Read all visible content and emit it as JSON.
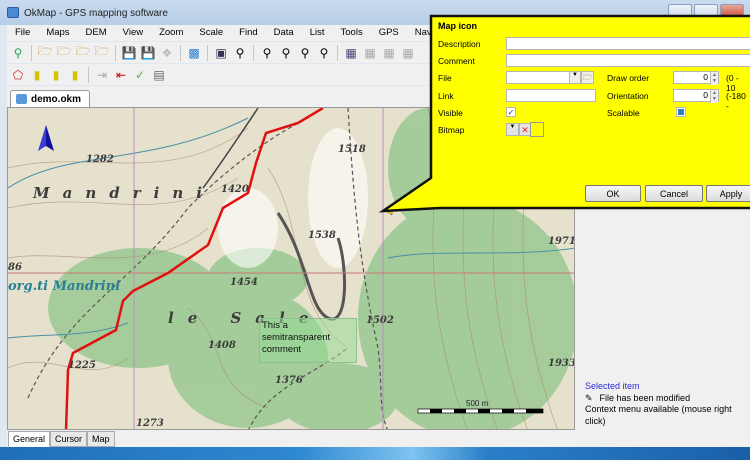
{
  "window": {
    "title": "OkMap - GPS mapping software"
  },
  "menu": [
    "File",
    "Maps",
    "DEM",
    "View",
    "Zoom",
    "Scale",
    "Find",
    "Data",
    "List",
    "Tools",
    "GPS",
    "Navigate"
  ],
  "toolbar_row1": [
    "find-map-icon",
    "open-map-icon",
    "open-calibrated-icon",
    "open-vector-icon",
    "open-image-icon",
    "save-as-icon",
    "save-icon",
    "save-disabled-icon",
    "select-map-icon",
    "map-properties-icon",
    "search-icon",
    "zoom-in-icon",
    "zoom-out-icon",
    "zoom-fit-icon",
    "zoom-1-1-icon",
    "grid-edit-icon",
    "grid-add-icon",
    "grid-fill-icon",
    "grid-delete-icon"
  ],
  "toolbar_row2": [
    "polygon-icon",
    "ruler-icon",
    "ruler-area-icon",
    "ruler-delete-icon",
    "import-disabled-icon",
    "export-red-icon",
    "export-check-icon",
    "properties-icon"
  ],
  "document_tab": "demo.okm",
  "map": {
    "labels": [
      "1282",
      "1420",
      "1518",
      "1538",
      "1971",
      "Mandrini",
      "86",
      "org.ti Mandrini",
      "1454",
      "le Sale",
      "1502",
      "1408",
      "1225",
      "1376",
      "1933",
      "1273"
    ],
    "comment": [
      "This a",
      "semitransparent",
      "comment"
    ],
    "scale_label": "500 m",
    "route_color": "#e01010"
  },
  "dialog": {
    "title": "Map icon",
    "description_label": "Description",
    "description_value": "",
    "comment_label": "Comment",
    "comment_value": "",
    "file_label": "File",
    "file_value": "",
    "link_label": "Link",
    "link_value": "",
    "visible_label": "Visible",
    "visible_checked": true,
    "bitmap_label": "Bitmap",
    "draw_order_label": "Draw order",
    "draw_order_value": "0",
    "draw_order_range": "(0 - 10",
    "orientation_label": "Orientation",
    "orientation_value": "0",
    "orientation_range": "(-180 -",
    "scalable_label": "Scalable",
    "scalable_checked": true,
    "ok": "OK",
    "cancel": "Cancel",
    "apply": "Apply",
    "background": "#ffff00"
  },
  "status": {
    "selected": "Selected item",
    "modified": "File has been modified",
    "context": "Context menu available (mouse right click)"
  },
  "bottom_tabs": [
    "General",
    "Cursor",
    "Map"
  ]
}
